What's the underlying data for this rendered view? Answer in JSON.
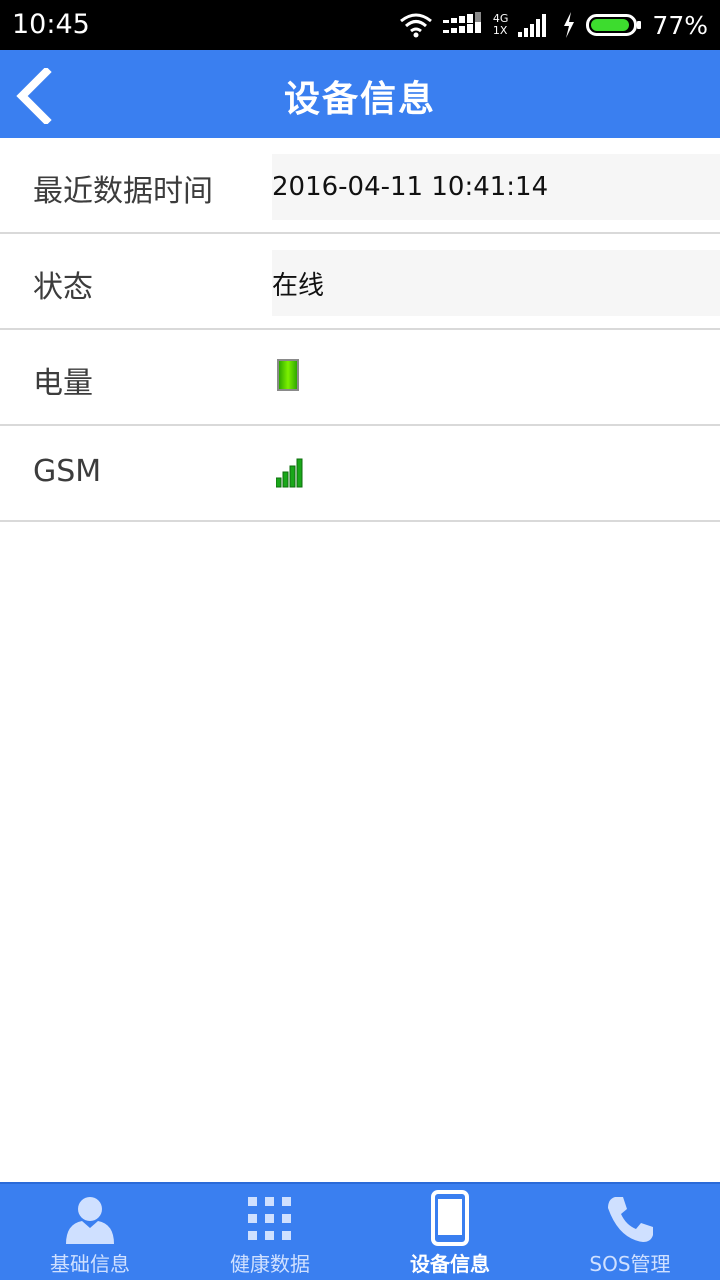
{
  "status_bar": {
    "time": "10:45",
    "network_labels": [
      "4G",
      "1X"
    ],
    "battery_percent": "77%"
  },
  "header": {
    "title": "设备信息",
    "back_icon": "chevron-left-icon"
  },
  "rows": [
    {
      "label": "最近数据时间",
      "value": "2016-04-11 10:41:14"
    },
    {
      "label": "状态",
      "value": "在线"
    },
    {
      "label": "电量",
      "value_icon": "battery-full-icon",
      "battery_level": 1.0
    },
    {
      "label": "GSM",
      "value_icon": "signal-bars-icon",
      "signal_bars": 4
    }
  ],
  "bottom_nav": {
    "items": [
      {
        "label": "基础信息",
        "icon": "person-icon",
        "active": false
      },
      {
        "label": "健康数据",
        "icon": "grid-icon",
        "active": false
      },
      {
        "label": "设备信息",
        "icon": "phone-device-icon",
        "active": true
      },
      {
        "label": "SOS管理",
        "icon": "phone-handset-icon",
        "active": false
      }
    ]
  },
  "colors": {
    "primary": "#3a7ff0",
    "battery_green": "#39c000",
    "signal_green": "#1aa71a"
  }
}
